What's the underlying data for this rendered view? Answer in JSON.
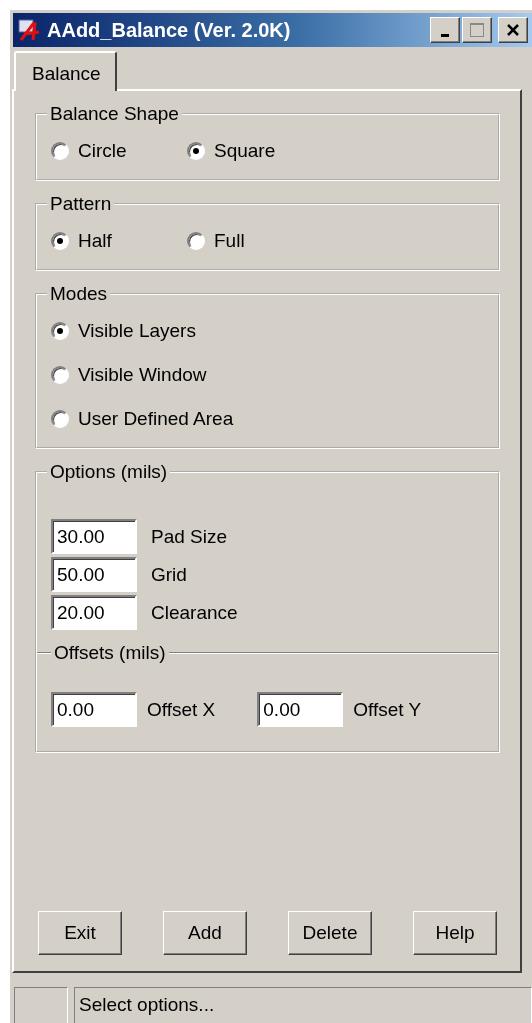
{
  "window": {
    "title": "AAdd_Balance (Ver. 2.0K)"
  },
  "tabs": [
    {
      "label": "Balance",
      "selected": true
    }
  ],
  "balance_shape": {
    "title": "Balance Shape",
    "options": [
      {
        "label": "Circle",
        "selected": false
      },
      {
        "label": "Square",
        "selected": true
      }
    ]
  },
  "pattern": {
    "title": "Pattern",
    "options": [
      {
        "label": "Half",
        "selected": true
      },
      {
        "label": "Full",
        "selected": false
      }
    ]
  },
  "modes": {
    "title": "Modes",
    "options": [
      {
        "label": "Visible Layers",
        "selected": true
      },
      {
        "label": "Visible Window",
        "selected": false
      },
      {
        "label": "User Defined Area",
        "selected": false
      }
    ]
  },
  "options": {
    "title": "Options (mils)",
    "fields": [
      {
        "value": "30.00",
        "label": "Pad Size"
      },
      {
        "value": "50.00",
        "label": "Grid"
      },
      {
        "value": "20.00",
        "label": "Clearance"
      }
    ],
    "offsets": {
      "title": "Offsets (mils)",
      "fields": [
        {
          "value": "0.00",
          "label": "Offset X"
        },
        {
          "value": "0.00",
          "label": "Offset Y"
        }
      ]
    }
  },
  "buttons": [
    "Exit",
    "Add",
    "Delete",
    "Help"
  ],
  "status_bar": {
    "text": "Select options..."
  }
}
